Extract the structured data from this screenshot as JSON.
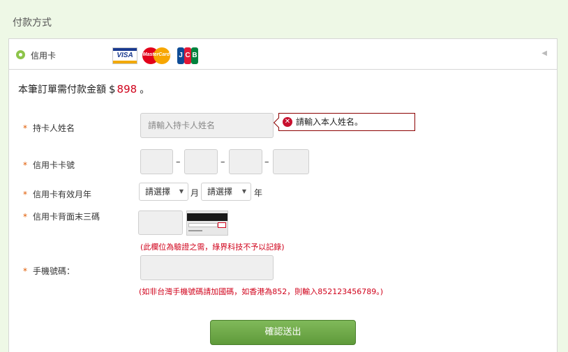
{
  "section_title": "付款方式",
  "payment_method": {
    "label": "信用卡",
    "selected": true,
    "card_brands": [
      {
        "icon": "visa-logo",
        "text": "VISA"
      },
      {
        "icon": "mastercard-logo",
        "text": "MasterCard"
      },
      {
        "icon": "jcb-logo",
        "text": "JCB"
      }
    ]
  },
  "amount": {
    "prefix": "本筆訂單需付款金額",
    "currency": "$",
    "value": "898",
    "suffix": "。"
  },
  "form": {
    "required_mark": "*",
    "cardholder": {
      "label": "持卡人姓名",
      "placeholder": "請輸入持卡人姓名",
      "value": "",
      "error": "請輸入本人姓名。"
    },
    "card_number": {
      "label": "信用卡卡號",
      "separator": "–"
    },
    "expiry": {
      "label": "信用卡有效月年",
      "month_select": "請選擇",
      "month_unit": "月",
      "year_select": "請選擇",
      "year_unit": "年"
    },
    "cvv": {
      "label": "信用卡背面末三碼",
      "hint": "(此欄位為驗證之需，綠界科技不予以記錄)"
    },
    "phone": {
      "label": "手機號碼：",
      "hint": "(如非台灣手機號碼請加國碼，如香港為852，則輸入852123456789。)"
    },
    "submit_label": "確認送出"
  },
  "colors": {
    "accent_green": "#8dc44a",
    "error_red": "#d0021b",
    "button_green": "#6aa644"
  }
}
